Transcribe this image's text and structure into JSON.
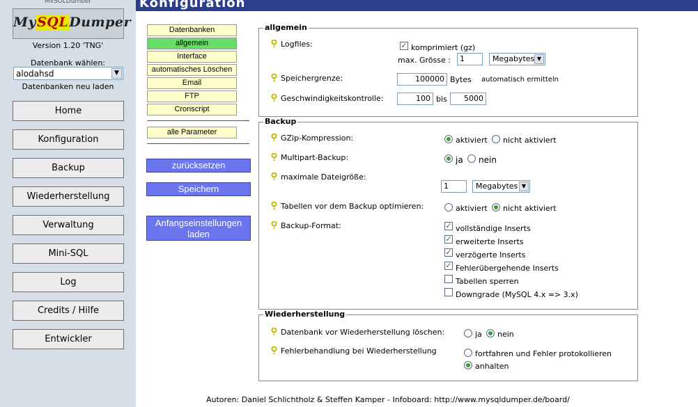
{
  "sidebar": {
    "top_text": "MySQLDumper",
    "logo_prefix": "My",
    "logo_sql": "SQL",
    "logo_suffix": "Dumper",
    "version": "Version 1.20 'TNG'",
    "db_label": "Datenbank wählen:",
    "db_selected": "alodahsd",
    "db_reload": "Datenbanken neu laden",
    "nav": [
      "Home",
      "Konfiguration",
      "Backup",
      "Wiederherstellung",
      "Verwaltung",
      "Mini-SQL",
      "Log",
      "Credits / Hilfe",
      "Entwickler"
    ]
  },
  "header": {
    "title": "Konfiguration"
  },
  "tabs": [
    "Datenbanken",
    "allgemein",
    "Interface",
    "automatisches Löschen",
    "Email",
    "FTP",
    "Cronscript"
  ],
  "all_params": "alle Parameter",
  "buttons": {
    "reset": "zurücksetzen",
    "save": "Speichern",
    "defaults_line1": "Anfangseinstellungen",
    "defaults_line2": "laden"
  },
  "general": {
    "legend": "allgemein",
    "logfiles_label": "Logfiles:",
    "compressed_label": "komprimiert (gz)",
    "maxsize_label": "max. Grösse :",
    "maxsize_value": "1",
    "maxsize_unit": "Megabytes",
    "memory_label": "Speichergrenze:",
    "memory_value": "100000",
    "memory_unit": "Bytes",
    "memory_auto": "automatisch ermitteln",
    "speed_label": "Geschwindigkeitskontrolle:",
    "speed_min": "100",
    "speed_bis": "bis",
    "speed_max": "5000"
  },
  "backup": {
    "legend": "Backup",
    "gzip_label": "GZip-Kompression:",
    "gzip_on": "aktiviert",
    "gzip_off": "nicht aktiviert",
    "multipart_label": "Multipart-Backup:",
    "multipart_yes": "ja",
    "multipart_no": "nein",
    "maxfile_label": "maximale Dateigröße:",
    "maxfile_value": "1",
    "maxfile_unit": "Megabytes",
    "optimize_label": "Tabellen vor dem Backup optimieren:",
    "optimize_on": "aktiviert",
    "optimize_off": "nicht aktiviert",
    "format_label": "Backup-Format:",
    "format_options": [
      "vollständige Inserts",
      "erweiterte Inserts",
      "verzögerte Inserts",
      "Fehlerübergehende Inserts",
      "Tabellen sperren",
      "Downgrade (MySQL 4.x => 3.x)"
    ]
  },
  "restore": {
    "legend": "Wiederherstellung",
    "delete_label": "Datenbank vor Wiederherstellung löschen:",
    "delete_yes": "ja",
    "delete_no": "nein",
    "error_label": "Fehlerbehandlung bei Wiederherstellung",
    "error_continue": "fortfahren und Fehler protokollieren",
    "error_stop": "anhalten"
  },
  "footer": "Autoren:  Daniel Schlichtholz & Steffen Kamper - Infoboard: http://www.mysqldumper.de/board/"
}
